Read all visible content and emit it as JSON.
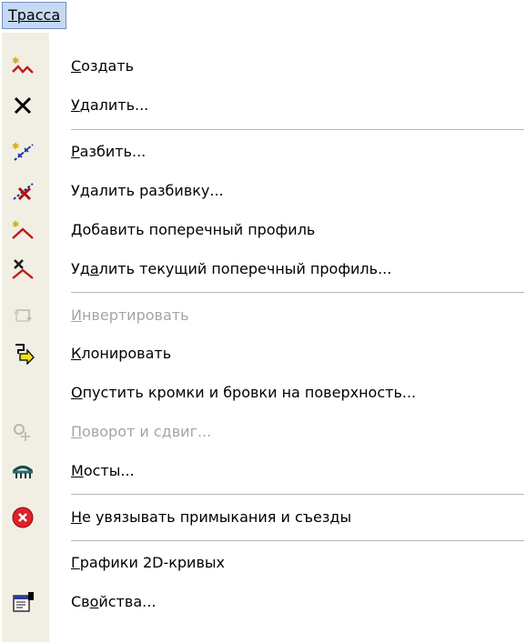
{
  "menu_title": "Трасса",
  "items": [
    {
      "name": "create",
      "accel": "С",
      "rest": "оздать",
      "disabled": false
    },
    {
      "name": "delete",
      "accel": "У",
      "rest": "далить...",
      "disabled": false
    },
    {
      "name": "split",
      "accel": "Р",
      "rest": "азбить...",
      "disabled": false
    },
    {
      "name": "remove-split",
      "pre": "Удалить разбивку...",
      "disabled": false
    },
    {
      "name": "add-cross-profile",
      "accel": "Д",
      "rest": "обавить поперечный профиль",
      "disabled": false
    },
    {
      "name": "delete-cross-profile",
      "pre": "Уд",
      "accel": "а",
      "rest": "лить текущий поперечный профиль...",
      "disabled": false
    },
    {
      "name": "invert",
      "accel": "И",
      "rest": "нвертировать",
      "disabled": true
    },
    {
      "name": "clone",
      "accel": "К",
      "rest": "лонировать",
      "disabled": false
    },
    {
      "name": "lower-edges",
      "accel": "О",
      "rest": "пустить кромки и бровки на поверхность...",
      "disabled": false
    },
    {
      "name": "rotate-shift",
      "accel": "П",
      "rest": "оворот и сдвиг...",
      "disabled": true
    },
    {
      "name": "bridges",
      "accel": "М",
      "rest": "осты...",
      "disabled": false
    },
    {
      "name": "no-junctions",
      "accel": "Н",
      "rest": "е увязывать примыкания и съезды",
      "disabled": false
    },
    {
      "name": "curves-2d",
      "accel": "Г",
      "rest": "рафики 2D-кривых",
      "disabled": false
    },
    {
      "name": "properties",
      "pre": "Св",
      "accel": "о",
      "rest": "йства...",
      "disabled": false
    }
  ],
  "icons": {
    "create": "create-route-icon",
    "delete": "delete-x-icon",
    "split": "split-icon",
    "remove-split": "remove-split-icon",
    "add-cross-profile": "add-profile-icon",
    "delete-cross-profile": "delete-profile-icon",
    "invert": "invert-icon",
    "clone": "clone-icon",
    "rotate-shift": "rotate-shift-icon",
    "bridges": "bridge-icon",
    "no-junctions": "error-circle-icon",
    "properties": "properties-icon"
  },
  "colors": {
    "menu_title_bg": "#c5d9f1",
    "gutter": "#f1efe3",
    "disabled_text": "#a5a5a5",
    "error_red": "#e0202a"
  }
}
